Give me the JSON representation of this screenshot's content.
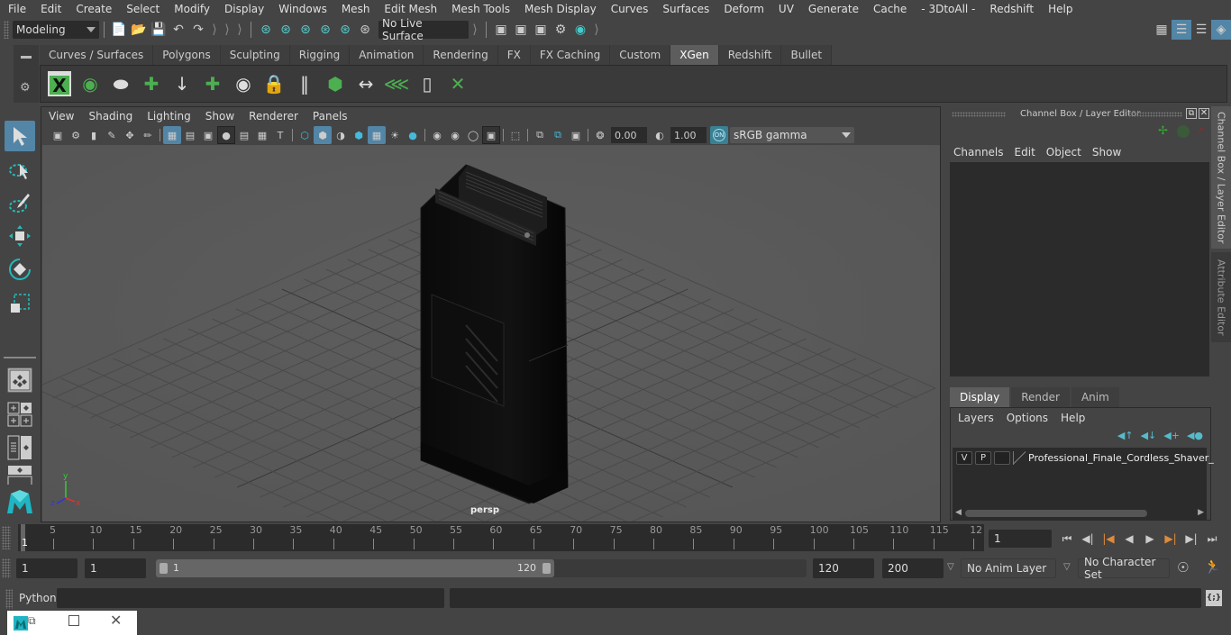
{
  "menubar": {
    "items": [
      "File",
      "Edit",
      "Create",
      "Select",
      "Modify",
      "Display",
      "Windows",
      "Mesh",
      "Edit Mesh",
      "Mesh Tools",
      "Mesh Display",
      "Curves",
      "Surfaces",
      "Deform",
      "UV",
      "Generate",
      "Cache",
      "- 3DtoAll -",
      "Redshift",
      "Help"
    ]
  },
  "statusline": {
    "mode_selector": "Modeling",
    "live_surface": "No Live Surface"
  },
  "shelf": {
    "tabs": [
      "Curves / Surfaces",
      "Polygons",
      "Sculpting",
      "Rigging",
      "Animation",
      "Rendering",
      "FX",
      "FX Caching",
      "Custom",
      "XGen",
      "Redshift",
      "Bullet"
    ],
    "active_tab": "XGen",
    "icons": [
      "xgen-description-editor-icon",
      "xgen-preview-icon",
      "xgen-hide-preview-icon",
      "xgen-create-groom-icon",
      "xgen-place-guides-icon",
      "xgen-add-guide-icon",
      "xgen-show-guides-icon",
      "xgen-lock-guides-icon",
      "xgen-split-guides-icon",
      "xgen-patch-icon",
      "xgen-scale-guides-icon",
      "xgen-select-guides-icon",
      "xgen-guide-shape-icon",
      "xgen-delete-guides-icon"
    ]
  },
  "viewport": {
    "menu": [
      "View",
      "Shading",
      "Lighting",
      "Show",
      "Renderer",
      "Panels"
    ],
    "exposure": "0.00",
    "gamma": "1.00",
    "color_space": "sRGB gamma",
    "color_mgmt_badge": "ON",
    "camera_label": "persp",
    "axis_labels": {
      "x": "x",
      "y": "y",
      "z": "z"
    }
  },
  "channel_box": {
    "title": "Channel Box / Layer Editor",
    "menu": [
      "Channels",
      "Edit",
      "Object",
      "Show"
    ]
  },
  "layer_editor": {
    "tabs": [
      "Display",
      "Render",
      "Anim"
    ],
    "active_tab": "Display",
    "menu": [
      "Layers",
      "Options",
      "Help"
    ],
    "layers": [
      {
        "v": "V",
        "p": "P",
        "name": "Professional_Finale_Cordless_Shaver_"
      }
    ]
  },
  "side_tabs": [
    "Channel Box / Layer Editor",
    "Attribute Editor"
  ],
  "timeline": {
    "ticks": [
      "5",
      "10",
      "15",
      "20",
      "25",
      "30",
      "35",
      "40",
      "45",
      "50",
      "55",
      "60",
      "65",
      "70",
      "75",
      "80",
      "85",
      "90",
      "95",
      "100",
      "105",
      "110",
      "115",
      "12"
    ],
    "current_frame_marker": "1",
    "current_frame_field": "1"
  },
  "range": {
    "start_field": "1",
    "playback_start": "1",
    "slider_start": "1",
    "slider_end": "120",
    "playback_end": "120",
    "end_field": "200",
    "anim_layer": "No Anim Layer",
    "character_set": "No Character Set"
  },
  "command_line": {
    "language": "Python",
    "input_value": "",
    "result_value": ""
  },
  "colors": {
    "accent_blue": "#5285a6",
    "xgen_green": "#4caf50",
    "maya_teal": "#1fb5c2",
    "playhead_orange": "#e08a3c"
  }
}
